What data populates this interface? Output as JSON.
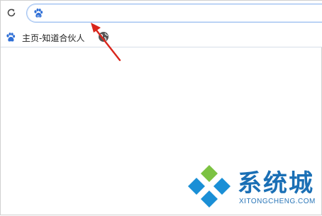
{
  "toolbar": {
    "refresh_icon": "refresh-icon",
    "address_icon": "baidu-paw-icon",
    "address_value": "",
    "address_border_color": "#9ec0f0"
  },
  "bookmarks": {
    "items": [
      {
        "label": "主页-知道合伙人",
        "icon": "baidu-paw-icon"
      }
    ],
    "extra_icon": "globe-icon"
  },
  "annotation": {
    "color": "#d9261c",
    "shape": "arrow"
  },
  "watermark": {
    "text": "系统城",
    "subtext": "XITONGCHENG.COM",
    "color": "#1a6fb5"
  }
}
